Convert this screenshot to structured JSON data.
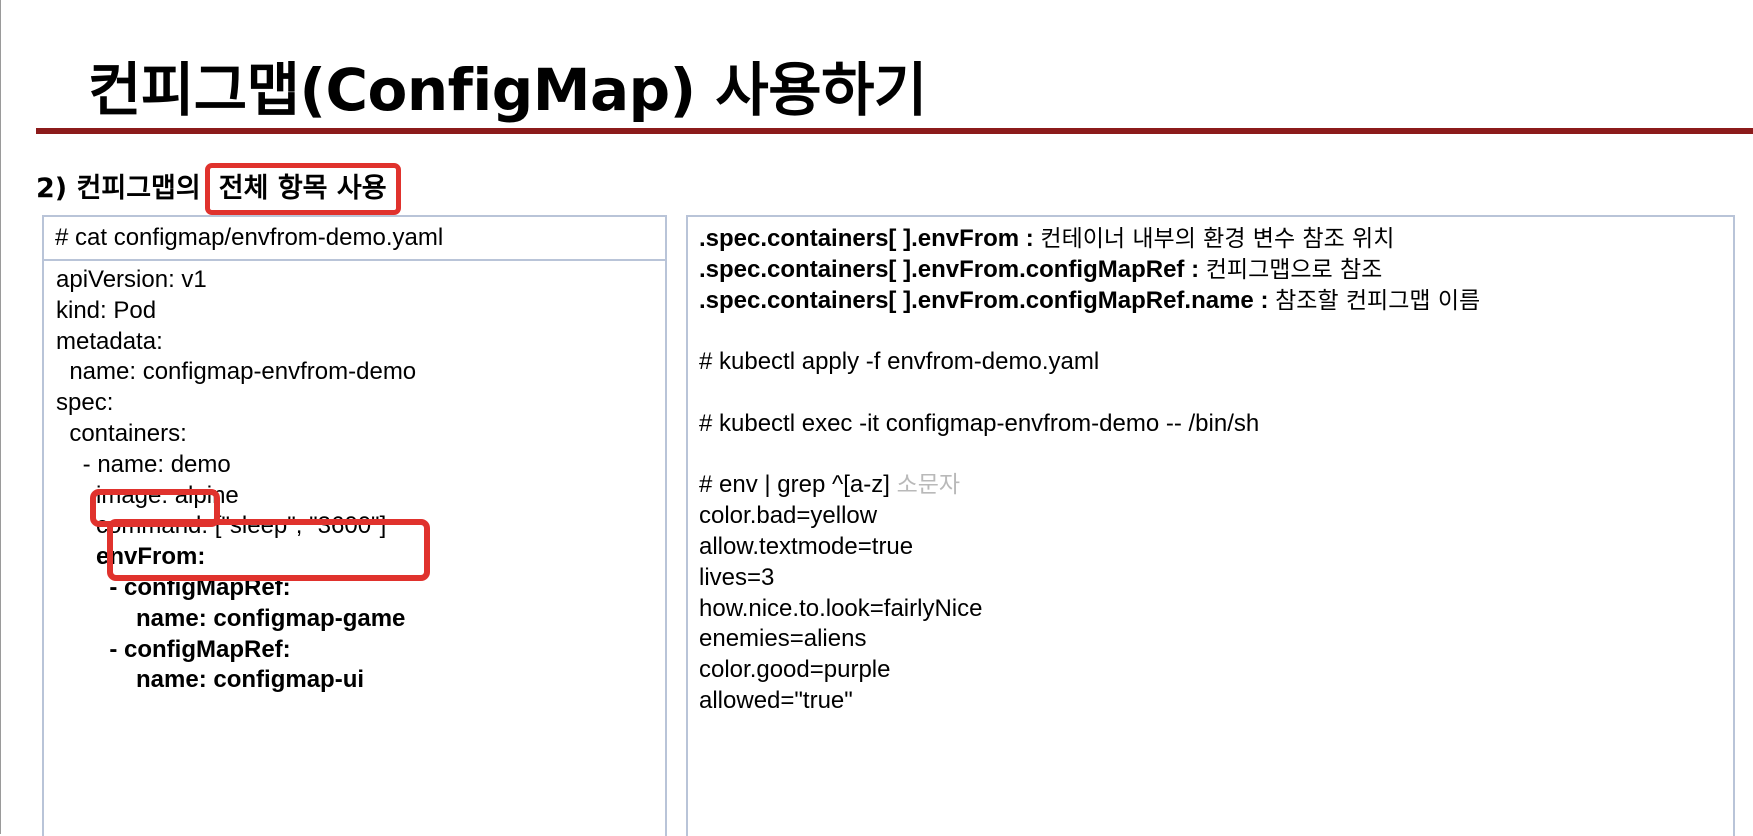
{
  "slide": {
    "title": "컨피그맵(ConfigMap) 사용하기",
    "subtitle_prefix": "2) 컨피그맵의",
    "subtitle_highlight": "전체 항목 사용"
  },
  "colors": {
    "title_rule": "#8c1b1b",
    "highlight_box": "#e0322d",
    "panel_border": "#b9c4d8",
    "note_text": "#b9b9b9"
  },
  "yaml_panel": {
    "header": "# cat configmap/envfrom-demo.yaml",
    "lines": [
      "apiVersion: v1",
      "kind: Pod",
      "metadata:",
      "  name: configmap-envfrom-demo",
      "spec:",
      "  containers:",
      "    - name: demo",
      "      image: alpine",
      "      command: [\"sleep\", \"3600\"]",
      "      envFrom:",
      "        - configMapRef:",
      "            name: configmap-game",
      "        - configMapRef:",
      "            name: configmap-ui"
    ]
  },
  "explain_panel": {
    "fields": [
      {
        "key": ".spec.containers[ ].envFrom :",
        "desc": "컨테이너 내부의 환경 변수 참조 위치"
      },
      {
        "key": ".spec.containers[ ].envFrom.configMapRef :",
        "desc": "컨피그맵으로 참조"
      },
      {
        "key": ".spec.containers[ ].envFrom.configMapRef.name :",
        "desc": "참조할 컨피그맵 이름"
      }
    ],
    "apply_cmd": "# kubectl apply -f envfrom-demo.yaml",
    "exec_cmd": "# kubectl exec -it configmap-envfrom-demo -- /bin/sh",
    "env_cmd": "# env | grep ^[a-z]",
    "env_cmd_note": "소문자",
    "env_output": [
      "color.bad=yellow",
      "allow.textmode=true",
      "lives=3",
      "how.nice.to.look=fairlyNice",
      "enemies=aliens",
      "color.good=purple",
      "allowed=\"true\""
    ]
  }
}
